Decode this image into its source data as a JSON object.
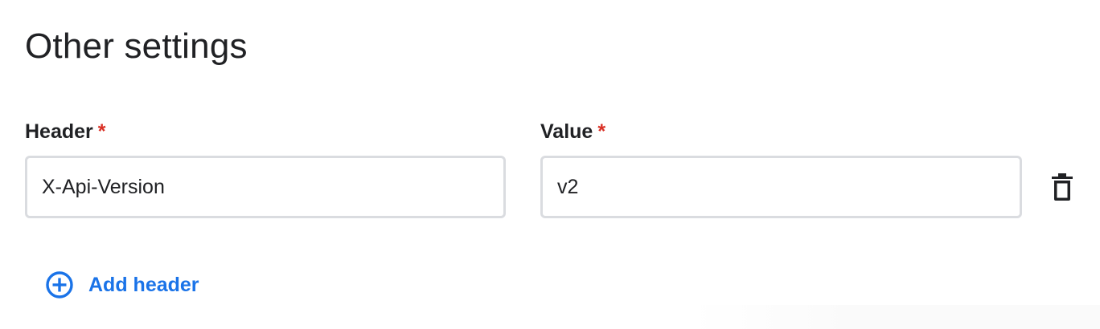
{
  "section": {
    "title": "Other settings"
  },
  "fields": {
    "header": {
      "label": "Header",
      "required_mark": "*",
      "value": "X-Api-Version"
    },
    "value": {
      "label": "Value",
      "required_mark": "*",
      "value": "v2"
    }
  },
  "actions": {
    "delete_icon": "trash-icon",
    "add_icon": "add-circle-icon",
    "add_label": "Add header"
  },
  "colors": {
    "accent": "#1a73e8",
    "required": "#d93025",
    "input_border": "#dadce0",
    "text": "#202124"
  }
}
